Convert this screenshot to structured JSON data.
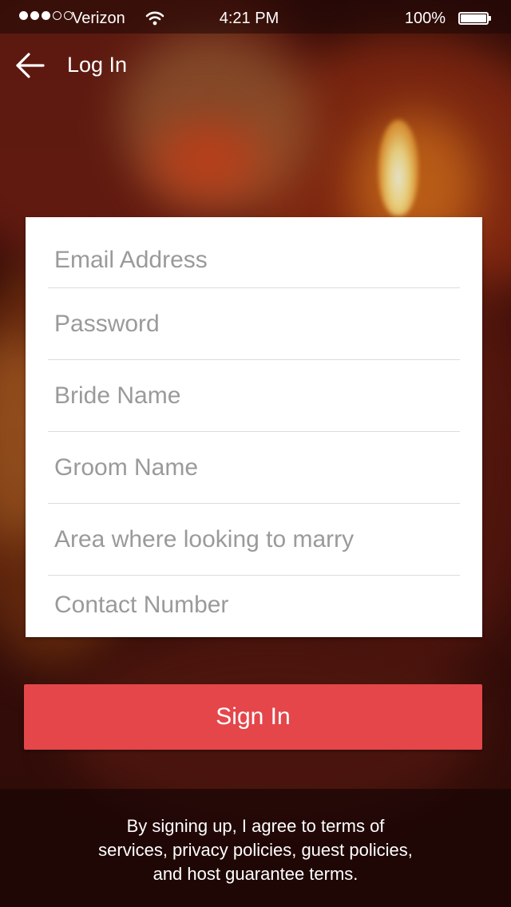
{
  "status_bar": {
    "carrier": "Verizon",
    "time": "4:21 PM",
    "battery": "100%",
    "signal_bars_filled": 3,
    "signal_bars_total": 5
  },
  "header": {
    "back_icon": "arrow-left-icon",
    "title": "Log In"
  },
  "form": {
    "fields": [
      {
        "name": "email",
        "placeholder": "Email Address"
      },
      {
        "name": "password",
        "placeholder": "Password"
      },
      {
        "name": "bride",
        "placeholder": "Bride Name"
      },
      {
        "name": "groom",
        "placeholder": "Groom Name"
      },
      {
        "name": "area",
        "placeholder": "Area where looking to marry"
      },
      {
        "name": "contact",
        "placeholder": "Contact Number"
      }
    ]
  },
  "actions": {
    "signin_label": "Sign In"
  },
  "footer": {
    "terms_lines": [
      "By signing up, I agree to  terms of",
      "services, privacy policies, guest policies,",
      "and host guarantee terms."
    ]
  },
  "colors": {
    "primary_button": "#e4464a",
    "card": "#ffffff",
    "placeholder": "#9a9a9a"
  }
}
